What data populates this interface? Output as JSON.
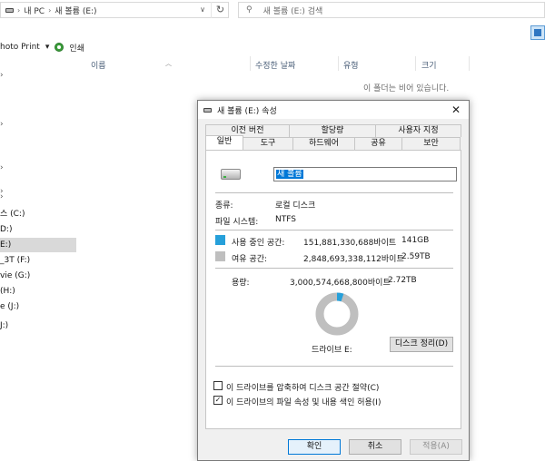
{
  "explorer": {
    "breadcrumb": [
      "내 PC",
      "새 볼륨 (E:)"
    ],
    "search_placeholder": "새 볼륨 (E:) 검색",
    "toolbar": {
      "photo_print": "hoto Print",
      "dropdown_caret": "▾",
      "print": "인쇄"
    },
    "columns": {
      "name": "이름",
      "modified": "수정한 날짜",
      "type": "유형",
      "size": "크기"
    },
    "empty_message": "이 폴더는 비어 있습니다.",
    "nav_items": [
      {
        "label": "스 (C:)"
      },
      {
        "label": "D:)"
      },
      {
        "label": "E:)",
        "selected": true
      },
      {
        "label": "_3T (F:)"
      },
      {
        "label": "vie (G:)"
      },
      {
        "label": "(H:)"
      },
      {
        "label": "e (J:)"
      },
      {
        "label": "J:)"
      }
    ],
    "nav_marks": [
      "›",
      "›",
      "›",
      "›",
      "›"
    ]
  },
  "dialog": {
    "title": "새 볼륨 (E:) 속성",
    "close_label": "✕",
    "tabs_row1": [
      "이전 버전",
      "할당량",
      "사용자 지정"
    ],
    "tabs_row2": [
      "일반",
      "도구",
      "하드웨어",
      "공유",
      "보안"
    ],
    "active_tab": "일반",
    "volume_name": "새 볼륨",
    "type_label": "종류:",
    "type_value": "로컬 디스크",
    "fs_label": "파일 시스템:",
    "fs_value": "NTFS",
    "used_label": "사용 중인 공간:",
    "used_bytes": "151,881,330,688바이트",
    "used_size": "141GB",
    "free_label": "여유 공간:",
    "free_bytes": "2,848,693,338,112바이트",
    "free_size": "2.59TB",
    "capacity_label": "용량:",
    "capacity_bytes": "3,000,574,668,800바이트",
    "capacity_size": "2.72TB",
    "used_fraction": 0.0506,
    "drive_label": "드라이브 E:",
    "cleanup_button": "디스크 정리(D)",
    "compress_label": "이 드라이브를 압축하여 디스크 공간 절약(C)",
    "compress_checked": false,
    "index_label": "이 드라이브의 파일 속성 및 내용 색인 허용(I)",
    "index_checked": true,
    "ok_button": "확인",
    "cancel_button": "취소",
    "apply_button": "적용(A)"
  },
  "colors": {
    "used": "#26a0da",
    "free": "#bfbfbf",
    "accent": "#0078d7"
  }
}
